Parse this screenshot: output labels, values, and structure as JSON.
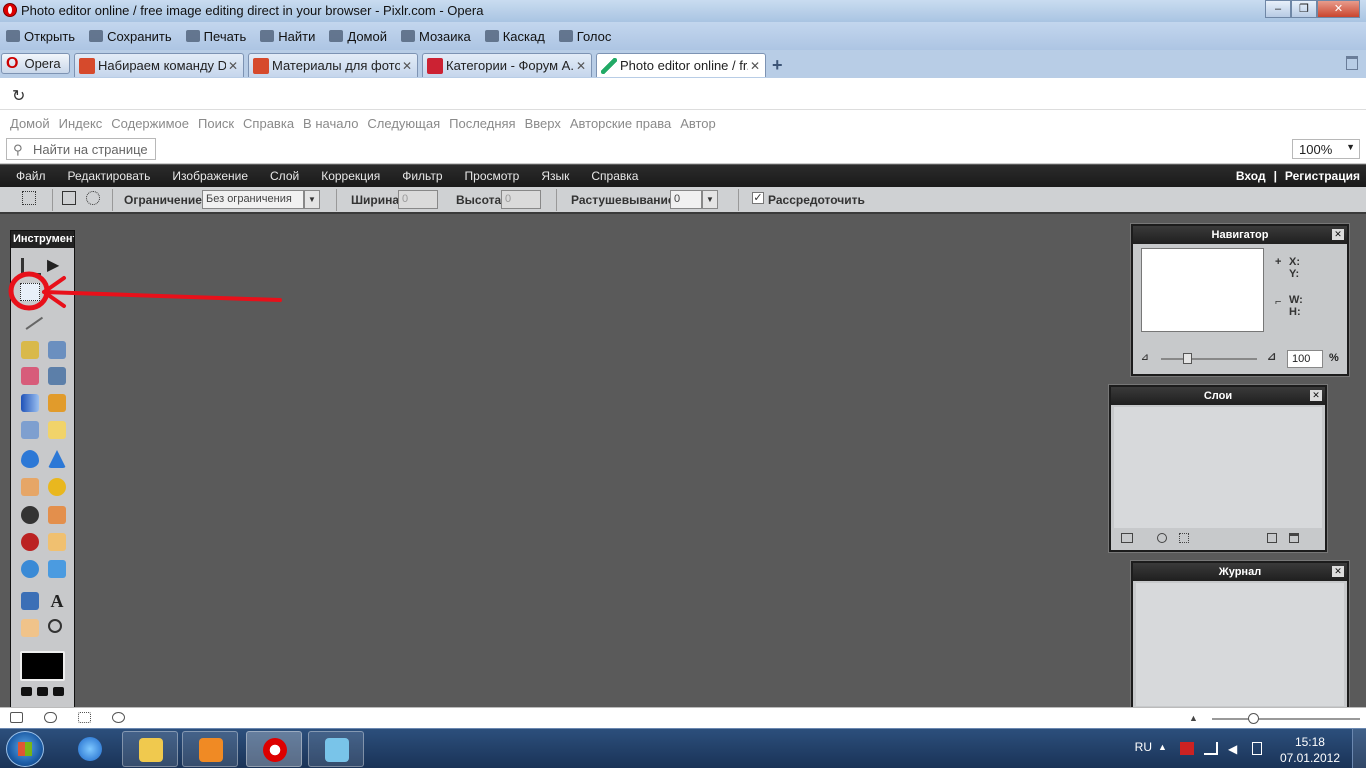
{
  "window": {
    "title": "Photo editor online / free image editing direct in your browser - Pixlr.com - Opera"
  },
  "opera_toolbar": {
    "items": [
      "Открыть",
      "Сохранить",
      "Печать",
      "Найти",
      "Домой",
      "Мозаика",
      "Каскад",
      "Голос"
    ]
  },
  "tabs": {
    "opera_menu": "Opera",
    "items": [
      {
        "label": "Набираем команду D..."
      },
      {
        "label": "Материалы для фото..."
      },
      {
        "label": "Категории - Форум А..."
      },
      {
        "label": "Photo editor online / fr..."
      }
    ]
  },
  "link_bar": {
    "items": [
      "Домой",
      "Индекс",
      "Содержимое",
      "Поиск",
      "Справка",
      "В начало",
      "Следующая",
      "Последняя",
      "Вверх",
      "Авторские права",
      "Автор"
    ]
  },
  "find": {
    "placeholder": "Найти на странице"
  },
  "zoom": {
    "value": "100%"
  },
  "pixlr_menu": {
    "items": [
      "Файл",
      "Редактировать",
      "Изображение",
      "Слой",
      "Коррекция",
      "Фильтр",
      "Просмотр",
      "Язык",
      "Справка"
    ],
    "login": "Вход",
    "separator": "|",
    "register": "Регистрация"
  },
  "options": {
    "constraint_label": "Ограничение:",
    "constraint_value": "Без ограничения",
    "width_label": "Ширина:",
    "width_value": "0",
    "height_label": "Высота:",
    "height_value": "0",
    "feather_label": "Растушевывание:",
    "feather_value": "0",
    "antialias_label": "Рассредоточить",
    "antialias_checked": true
  },
  "tools_panel": {
    "title": "Инструмент"
  },
  "navigator": {
    "title": "Навигатор",
    "x_label": "X:",
    "y_label": "Y:",
    "w_label": "W:",
    "h_label": "H:",
    "zoom_value": "100",
    "percent": "%"
  },
  "layers": {
    "title": "Слои"
  },
  "history": {
    "title": "Журнал"
  },
  "taskbar": {
    "lang": "RU",
    "time": "15:18",
    "date": "07.01.2012"
  },
  "colors": {
    "annotation": "#e8101a",
    "pixlr_bg": "#5a5a5a",
    "panel_bg": "#c7c9cb"
  }
}
